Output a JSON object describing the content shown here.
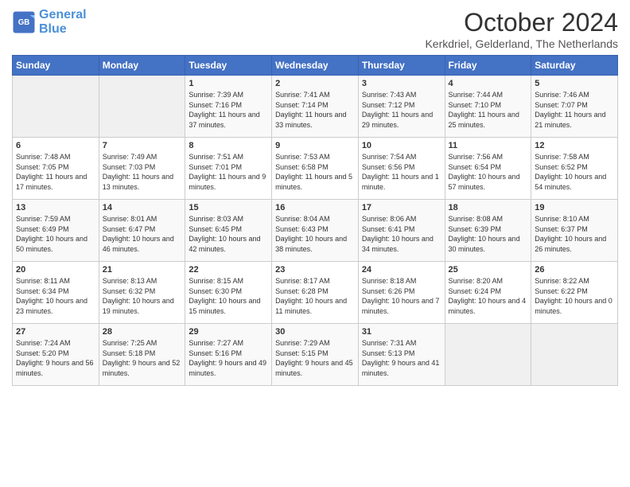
{
  "logo": {
    "line1": "General",
    "line2": "Blue"
  },
  "title": "October 2024",
  "subtitle": "Kerkdriel, Gelderland, The Netherlands",
  "headers": [
    "Sunday",
    "Monday",
    "Tuesday",
    "Wednesday",
    "Thursday",
    "Friday",
    "Saturday"
  ],
  "weeks": [
    [
      {
        "day": "",
        "sunrise": "",
        "sunset": "",
        "daylight": ""
      },
      {
        "day": "",
        "sunrise": "",
        "sunset": "",
        "daylight": ""
      },
      {
        "day": "1",
        "sunrise": "Sunrise: 7:39 AM",
        "sunset": "Sunset: 7:16 PM",
        "daylight": "Daylight: 11 hours and 37 minutes."
      },
      {
        "day": "2",
        "sunrise": "Sunrise: 7:41 AM",
        "sunset": "Sunset: 7:14 PM",
        "daylight": "Daylight: 11 hours and 33 minutes."
      },
      {
        "day": "3",
        "sunrise": "Sunrise: 7:43 AM",
        "sunset": "Sunset: 7:12 PM",
        "daylight": "Daylight: 11 hours and 29 minutes."
      },
      {
        "day": "4",
        "sunrise": "Sunrise: 7:44 AM",
        "sunset": "Sunset: 7:10 PM",
        "daylight": "Daylight: 11 hours and 25 minutes."
      },
      {
        "day": "5",
        "sunrise": "Sunrise: 7:46 AM",
        "sunset": "Sunset: 7:07 PM",
        "daylight": "Daylight: 11 hours and 21 minutes."
      }
    ],
    [
      {
        "day": "6",
        "sunrise": "Sunrise: 7:48 AM",
        "sunset": "Sunset: 7:05 PM",
        "daylight": "Daylight: 11 hours and 17 minutes."
      },
      {
        "day": "7",
        "sunrise": "Sunrise: 7:49 AM",
        "sunset": "Sunset: 7:03 PM",
        "daylight": "Daylight: 11 hours and 13 minutes."
      },
      {
        "day": "8",
        "sunrise": "Sunrise: 7:51 AM",
        "sunset": "Sunset: 7:01 PM",
        "daylight": "Daylight: 11 hours and 9 minutes."
      },
      {
        "day": "9",
        "sunrise": "Sunrise: 7:53 AM",
        "sunset": "Sunset: 6:58 PM",
        "daylight": "Daylight: 11 hours and 5 minutes."
      },
      {
        "day": "10",
        "sunrise": "Sunrise: 7:54 AM",
        "sunset": "Sunset: 6:56 PM",
        "daylight": "Daylight: 11 hours and 1 minute."
      },
      {
        "day": "11",
        "sunrise": "Sunrise: 7:56 AM",
        "sunset": "Sunset: 6:54 PM",
        "daylight": "Daylight: 10 hours and 57 minutes."
      },
      {
        "day": "12",
        "sunrise": "Sunrise: 7:58 AM",
        "sunset": "Sunset: 6:52 PM",
        "daylight": "Daylight: 10 hours and 54 minutes."
      }
    ],
    [
      {
        "day": "13",
        "sunrise": "Sunrise: 7:59 AM",
        "sunset": "Sunset: 6:49 PM",
        "daylight": "Daylight: 10 hours and 50 minutes."
      },
      {
        "day": "14",
        "sunrise": "Sunrise: 8:01 AM",
        "sunset": "Sunset: 6:47 PM",
        "daylight": "Daylight: 10 hours and 46 minutes."
      },
      {
        "day": "15",
        "sunrise": "Sunrise: 8:03 AM",
        "sunset": "Sunset: 6:45 PM",
        "daylight": "Daylight: 10 hours and 42 minutes."
      },
      {
        "day": "16",
        "sunrise": "Sunrise: 8:04 AM",
        "sunset": "Sunset: 6:43 PM",
        "daylight": "Daylight: 10 hours and 38 minutes."
      },
      {
        "day": "17",
        "sunrise": "Sunrise: 8:06 AM",
        "sunset": "Sunset: 6:41 PM",
        "daylight": "Daylight: 10 hours and 34 minutes."
      },
      {
        "day": "18",
        "sunrise": "Sunrise: 8:08 AM",
        "sunset": "Sunset: 6:39 PM",
        "daylight": "Daylight: 10 hours and 30 minutes."
      },
      {
        "day": "19",
        "sunrise": "Sunrise: 8:10 AM",
        "sunset": "Sunset: 6:37 PM",
        "daylight": "Daylight: 10 hours and 26 minutes."
      }
    ],
    [
      {
        "day": "20",
        "sunrise": "Sunrise: 8:11 AM",
        "sunset": "Sunset: 6:34 PM",
        "daylight": "Daylight: 10 hours and 23 minutes."
      },
      {
        "day": "21",
        "sunrise": "Sunrise: 8:13 AM",
        "sunset": "Sunset: 6:32 PM",
        "daylight": "Daylight: 10 hours and 19 minutes."
      },
      {
        "day": "22",
        "sunrise": "Sunrise: 8:15 AM",
        "sunset": "Sunset: 6:30 PM",
        "daylight": "Daylight: 10 hours and 15 minutes."
      },
      {
        "day": "23",
        "sunrise": "Sunrise: 8:17 AM",
        "sunset": "Sunset: 6:28 PM",
        "daylight": "Daylight: 10 hours and 11 minutes."
      },
      {
        "day": "24",
        "sunrise": "Sunrise: 8:18 AM",
        "sunset": "Sunset: 6:26 PM",
        "daylight": "Daylight: 10 hours and 7 minutes."
      },
      {
        "day": "25",
        "sunrise": "Sunrise: 8:20 AM",
        "sunset": "Sunset: 6:24 PM",
        "daylight": "Daylight: 10 hours and 4 minutes."
      },
      {
        "day": "26",
        "sunrise": "Sunrise: 8:22 AM",
        "sunset": "Sunset: 6:22 PM",
        "daylight": "Daylight: 10 hours and 0 minutes."
      }
    ],
    [
      {
        "day": "27",
        "sunrise": "Sunrise: 7:24 AM",
        "sunset": "Sunset: 5:20 PM",
        "daylight": "Daylight: 9 hours and 56 minutes."
      },
      {
        "day": "28",
        "sunrise": "Sunrise: 7:25 AM",
        "sunset": "Sunset: 5:18 PM",
        "daylight": "Daylight: 9 hours and 52 minutes."
      },
      {
        "day": "29",
        "sunrise": "Sunrise: 7:27 AM",
        "sunset": "Sunset: 5:16 PM",
        "daylight": "Daylight: 9 hours and 49 minutes."
      },
      {
        "day": "30",
        "sunrise": "Sunrise: 7:29 AM",
        "sunset": "Sunset: 5:15 PM",
        "daylight": "Daylight: 9 hours and 45 minutes."
      },
      {
        "day": "31",
        "sunrise": "Sunrise: 7:31 AM",
        "sunset": "Sunset: 5:13 PM",
        "daylight": "Daylight: 9 hours and 41 minutes."
      },
      {
        "day": "",
        "sunrise": "",
        "sunset": "",
        "daylight": ""
      },
      {
        "day": "",
        "sunrise": "",
        "sunset": "",
        "daylight": ""
      }
    ]
  ]
}
